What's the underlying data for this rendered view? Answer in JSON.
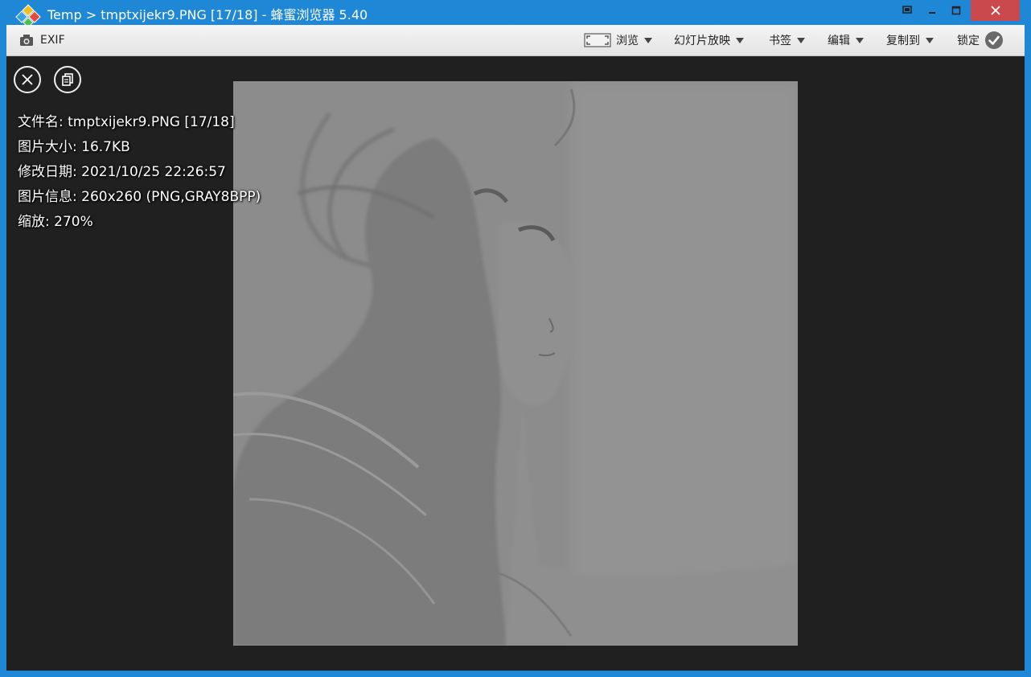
{
  "window": {
    "title": "Temp > tmptxijekr9.PNG [17/18] - 蜂蜜浏览器 5.40"
  },
  "toolbar": {
    "exif_label": "EXIF",
    "browse_label": "浏览",
    "slideshow_label": "幻灯片放映",
    "bookmark_label": "书签",
    "edit_label": "编辑",
    "copyto_label": "复制到",
    "lock_label": "锁定"
  },
  "info": {
    "filename": "文件名: tmptxijekr9.PNG [17/18]",
    "filesize": "图片大小: 16.7KB",
    "modified": "修改日期: 2021/10/25 22:26:57",
    "imageinfo": "图片信息: 260x260 (PNG,GRAY8BPP)",
    "zoom": "缩放: 270%"
  },
  "colors": {
    "titlebar": "#1e87d6",
    "close_button": "#c9494c",
    "viewer_background": "#202020",
    "image_gray": "#8a8a8a"
  },
  "icons": {
    "app": "honeyview-logo-icon",
    "exif": "camera-icon",
    "browse": "fullscreen-icon",
    "lock": "check-circle-icon",
    "close_overlay": "close-icon",
    "copy_overlay": "copy-icon"
  }
}
